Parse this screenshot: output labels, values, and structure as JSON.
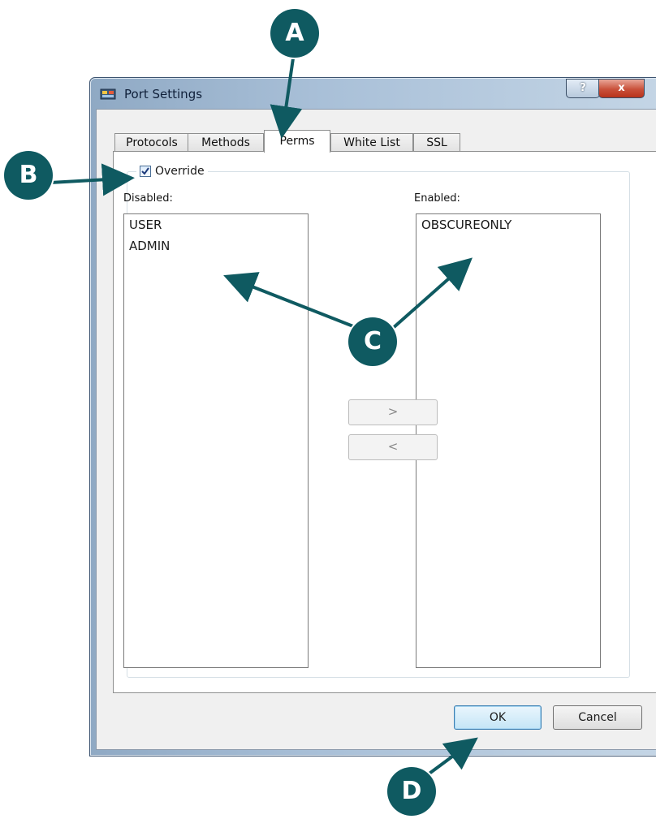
{
  "window": {
    "title": "Port Settings",
    "help": "?",
    "close": "x"
  },
  "tabs": [
    "Protocols",
    "Methods",
    "Perms",
    "White List",
    "SSL"
  ],
  "override": {
    "label": "Override",
    "checked": true
  },
  "disabled": {
    "label": "Disabled:",
    "items": [
      "USER",
      "ADMIN"
    ]
  },
  "enabled": {
    "label": "Enabled:",
    "items": [
      "OBSCUREONLY"
    ]
  },
  "move": {
    "right": ">",
    "left": "<"
  },
  "footer": {
    "ok": "OK",
    "cancel": "Cancel"
  },
  "callouts": {
    "a": "A",
    "b": "B",
    "c": "C",
    "d": "D"
  },
  "colors": {
    "callout": "#0f5a61"
  }
}
